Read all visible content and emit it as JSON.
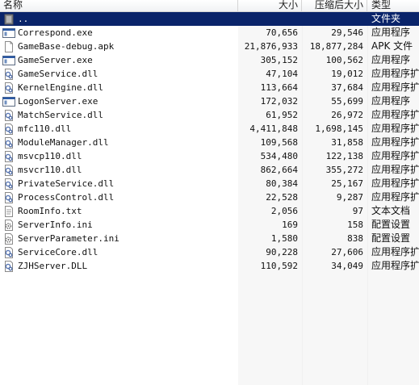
{
  "columns": {
    "name": "名称",
    "size": "大小",
    "compressed_size": "压缩后大小",
    "type": "类型"
  },
  "files": [
    {
      "name": "..",
      "size": "",
      "compressed": "",
      "type": "文件夹",
      "icon": "folder-up-icon",
      "selected": true
    },
    {
      "name": "Correspond.exe",
      "size": "70,656",
      "compressed": "29,546",
      "type": "应用程序",
      "icon": "exe-icon"
    },
    {
      "name": "GameBase-debug.apk",
      "size": "21,876,933",
      "compressed": "18,877,284",
      "type": "APK 文件",
      "icon": "blank-file-icon"
    },
    {
      "name": "GameServer.exe",
      "size": "305,152",
      "compressed": "100,562",
      "type": "应用程序",
      "icon": "exe-icon"
    },
    {
      "name": "GameService.dll",
      "size": "47,104",
      "compressed": "19,012",
      "type": "应用程序扩",
      "icon": "dll-icon"
    },
    {
      "name": "KernelEngine.dll",
      "size": "113,664",
      "compressed": "37,684",
      "type": "应用程序扩",
      "icon": "dll-icon"
    },
    {
      "name": "LogonServer.exe",
      "size": "172,032",
      "compressed": "55,699",
      "type": "应用程序",
      "icon": "exe-icon"
    },
    {
      "name": "MatchService.dll",
      "size": "61,952",
      "compressed": "26,972",
      "type": "应用程序扩",
      "icon": "dll-icon"
    },
    {
      "name": "mfc110.dll",
      "size": "4,411,848",
      "compressed": "1,698,145",
      "type": "应用程序扩",
      "icon": "dll-icon"
    },
    {
      "name": "ModuleManager.dll",
      "size": "109,568",
      "compressed": "31,858",
      "type": "应用程序扩",
      "icon": "dll-icon"
    },
    {
      "name": "msvcp110.dll",
      "size": "534,480",
      "compressed": "122,138",
      "type": "应用程序扩",
      "icon": "dll-icon"
    },
    {
      "name": "msvcr110.dll",
      "size": "862,664",
      "compressed": "355,272",
      "type": "应用程序扩",
      "icon": "dll-icon"
    },
    {
      "name": "PrivateService.dll",
      "size": "80,384",
      "compressed": "25,167",
      "type": "应用程序扩",
      "icon": "dll-icon"
    },
    {
      "name": "ProcessControl.dll",
      "size": "22,528",
      "compressed": "9,287",
      "type": "应用程序扩",
      "icon": "dll-icon"
    },
    {
      "name": "RoomInfo.txt",
      "size": "2,056",
      "compressed": "97",
      "type": "文本文档",
      "icon": "txt-icon"
    },
    {
      "name": "ServerInfo.ini",
      "size": "169",
      "compressed": "158",
      "type": "配置设置",
      "icon": "ini-icon"
    },
    {
      "name": "ServerParameter.ini",
      "size": "1,580",
      "compressed": "838",
      "type": "配置设置",
      "icon": "ini-icon"
    },
    {
      "name": "ServiceCore.dll",
      "size": "90,228",
      "compressed": "27,606",
      "type": "应用程序扩",
      "icon": "dll-icon"
    },
    {
      "name": "ZJHServer.DLL",
      "size": "110,592",
      "compressed": "34,049",
      "type": "应用程序扩",
      "icon": "dll-icon"
    }
  ],
  "colors": {
    "selection": "#0a246a",
    "header_bg": "#f1f2f4",
    "column_band": "#f7f7f7"
  }
}
